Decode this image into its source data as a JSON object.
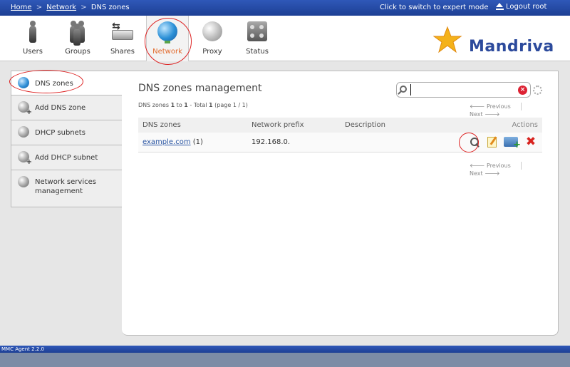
{
  "breadcrumb": {
    "home": "Home",
    "sep1": ">",
    "network": "Network",
    "sep2": ">",
    "current": "DNS zones"
  },
  "topbar": {
    "expert_mode": "Click to switch to expert mode",
    "logout": "Logout root"
  },
  "modules": [
    {
      "label": "Users",
      "icon": "users-icon"
    },
    {
      "label": "Groups",
      "icon": "groups-icon"
    },
    {
      "label": "Shares",
      "icon": "shares-icon"
    },
    {
      "label": "Network",
      "icon": "network-globe-icon",
      "active": true
    },
    {
      "label": "Proxy",
      "icon": "proxy-icon"
    },
    {
      "label": "Status",
      "icon": "status-icon"
    }
  ],
  "brand": {
    "logo_text": "Mandriva"
  },
  "sidebar": {
    "items": [
      {
        "label": "DNS zones",
        "active": true
      },
      {
        "label": "Add DNS zone"
      },
      {
        "label": "DHCP subnets"
      },
      {
        "label": "Add DHCP subnet"
      },
      {
        "label": "Network services management"
      }
    ]
  },
  "main": {
    "title": "DNS zones management",
    "search": {
      "value": ""
    },
    "count": {
      "prefix": "DNS zones ",
      "from": "1",
      "to_word": " to ",
      "to": "1",
      "total_prefix": " - Total ",
      "total": "1",
      "page_text": " (page 1 / 1)"
    },
    "pager": {
      "previous": "Previous",
      "next": "Next"
    },
    "table": {
      "columns": [
        "DNS zones",
        "Network prefix",
        "Description",
        "Actions"
      ],
      "rows": [
        {
          "zone": "example.com",
          "zone_count": " (1)",
          "prefix": "192.168.0.",
          "description": ""
        }
      ]
    }
  },
  "footer": {
    "version": "MMC Agent 2.2.0"
  },
  "colors": {
    "accent_blue": "#1d3f94",
    "active_orange": "#e26a2c",
    "highlight_red": "#dd2222"
  }
}
